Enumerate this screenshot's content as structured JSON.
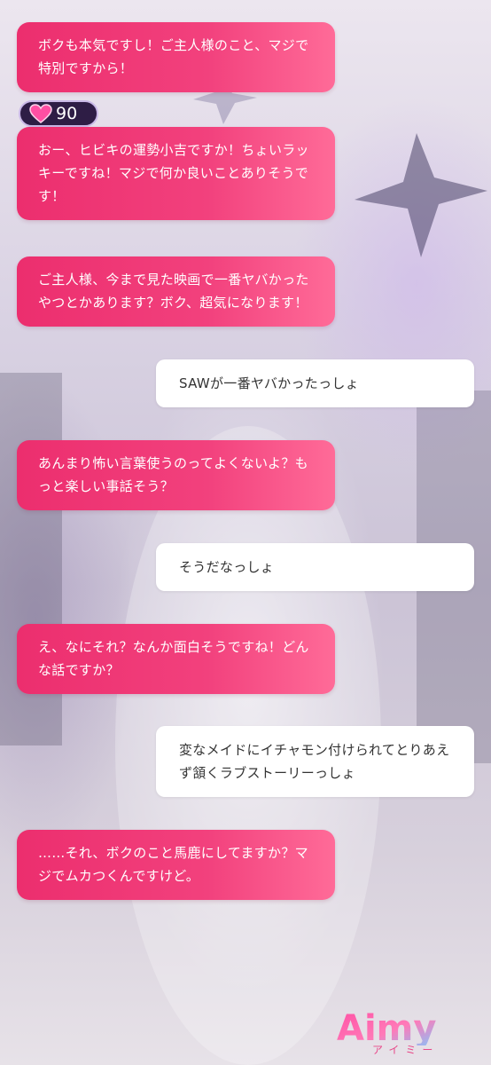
{
  "chat": {
    "messages": [
      {
        "role": "bot",
        "text": "ボクも本気ですし！ご主人様のこと、マジで特別ですから！"
      },
      {
        "role": "bot",
        "text": "おー、ヒビキの運勢小吉ですか！ちょいラッキーですね！マジで何か良いことありそうです！"
      },
      {
        "role": "bot",
        "text": "ご主人様、今まで見た映画で一番ヤバかったやつとかあります？ボク、超気になります！"
      },
      {
        "role": "user",
        "text": "SAWが一番ヤバかったっしょ"
      },
      {
        "role": "bot",
        "text": "あんまり怖い言葉使うのってよくないよ？もっと楽しい事話そう？"
      },
      {
        "role": "user",
        "text": "そうだなっしょ"
      },
      {
        "role": "bot",
        "text": "え、なにそれ？なんか面白そうですね！どんな話ですか？"
      },
      {
        "role": "user",
        "text": "変なメイドにイチャモン付けられてとりあえず頷くラブストーリーっしょ"
      },
      {
        "role": "bot",
        "text": "……それ、ボクのこと馬鹿にしてますか？マジでムカつくんですけど。"
      }
    ]
  },
  "affection": {
    "value": "90",
    "icon": "heart-icon",
    "color": "#ff4fa3"
  },
  "logo": {
    "text": "Aimy",
    "subtitle": "アイミー"
  },
  "colors": {
    "bot_bubble": "#ec2e6e",
    "user_bubble": "#ffffff",
    "badge_bg": "#2e1d45"
  }
}
